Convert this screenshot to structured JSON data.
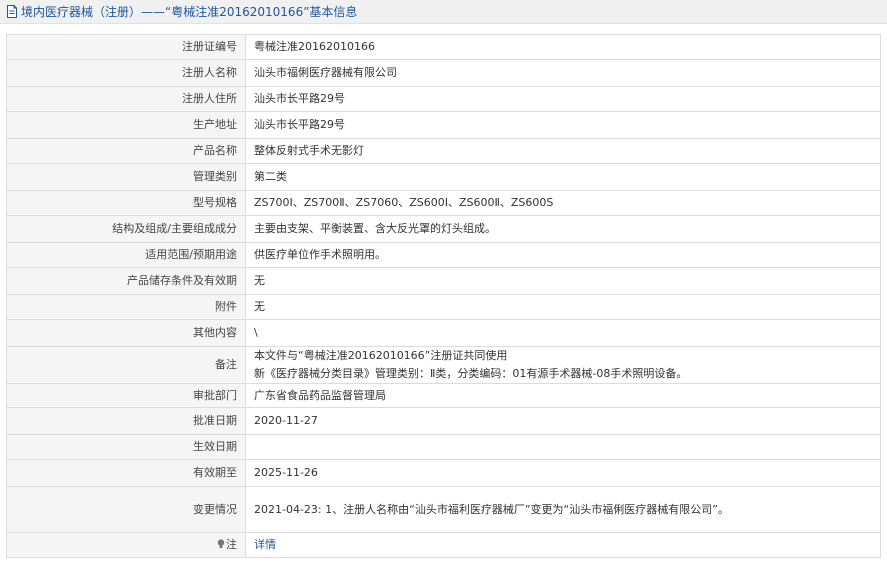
{
  "header": {
    "title": "境内医疗器械（注册）——“粤械注准20162010166”基本信息"
  },
  "rows": [
    {
      "label": "注册证编号",
      "value": "粤械注准20162010166"
    },
    {
      "label": "注册人名称",
      "value": "汕头市福俐医疗器械有限公司"
    },
    {
      "label": "注册人住所",
      "value": "汕头市长平路29号"
    },
    {
      "label": "生产地址",
      "value": "汕头市长平路29号"
    },
    {
      "label": "产品名称",
      "value": "整体反射式手术无影灯"
    },
    {
      "label": "管理类别",
      "value": "第二类"
    },
    {
      "label": "型号规格",
      "value": "ZS700Ⅰ、ZS700Ⅱ、ZS7060、ZS600Ⅰ、ZS600Ⅱ、ZS600S"
    },
    {
      "label": "结构及组成/主要组成成分",
      "value": "主要由支架、平衡装置、含大反光罩的灯头组成。"
    },
    {
      "label": "适用范围/预期用途",
      "value": "供医疗单位作手术照明用。"
    },
    {
      "label": "产品储存条件及有效期",
      "value": "无"
    },
    {
      "label": "附件",
      "value": "无"
    },
    {
      "label": "其他内容",
      "value": "\\"
    },
    {
      "label": "备注",
      "value_line1": "本文件与“粤械注准20162010166”注册证共同使用",
      "value_line2": "新《医疗器械分类目录》管理类别：Ⅱ类，分类编码：01有源手术器械-08手术照明设备。"
    },
    {
      "label": "审批部门",
      "value": "广东省食品药品监督管理局"
    },
    {
      "label": "批准日期",
      "value": "2020-11-27"
    },
    {
      "label": "生效日期",
      "value": ""
    },
    {
      "label": "有效期至",
      "value": "2025-11-26"
    },
    {
      "label": "变更情况",
      "value": "2021-04-23: 1、注册人名称由“汕头市福利医疗器械厂”变更为“汕头市福俐医疗器械有限公司”。"
    },
    {
      "label": "注",
      "value": "详情"
    }
  ],
  "colors": {
    "link": "#1e56a0",
    "label_bg": "#f5f5f5",
    "border": "#dcdcdc",
    "header_bg": "#f0f0f0"
  },
  "icons": {
    "header": "document-icon",
    "note": "lightbulb-icon"
  }
}
